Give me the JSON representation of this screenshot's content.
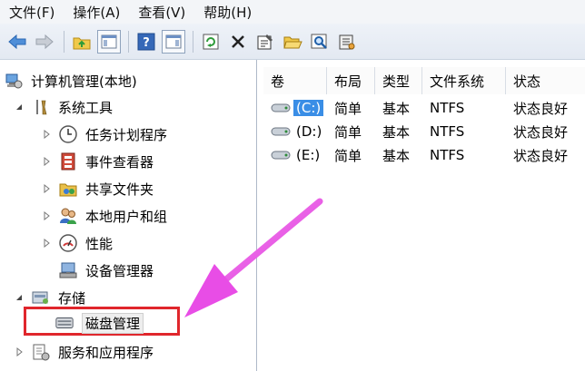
{
  "menu": [
    "文件(F)",
    "操作(A)",
    "查看(V)",
    "帮助(H)"
  ],
  "toolbar": {
    "buttons": [
      "back-arrow-icon",
      "forward-arrow-icon",
      "up-folder-icon",
      "show-hide-tree-icon",
      "help-icon",
      "show-action-pane-icon",
      "refresh-icon",
      "delete-icon",
      "properties-icon",
      "open-icon",
      "search-icon",
      "settings-icon"
    ]
  },
  "tree": {
    "root": "计算机管理(本地)",
    "system_tools": "系统工具",
    "task_scheduler": "任务计划程序",
    "event_viewer": "事件查看器",
    "shared_folders": "共享文件夹",
    "local_users": "本地用户和组",
    "performance": "性能",
    "device_manager": "设备管理器",
    "storage": "存储",
    "disk_management": "磁盘管理",
    "services": "服务和应用程序"
  },
  "table": {
    "headers": [
      "卷",
      "布局",
      "类型",
      "文件系统",
      "状态"
    ],
    "rows": [
      {
        "volume": "(C:)",
        "layout": "简单",
        "type": "基本",
        "fs": "NTFS",
        "status": "状态良好"
      },
      {
        "volume": "(D:)",
        "layout": "简单",
        "type": "基本",
        "fs": "NTFS",
        "status": "状态良好"
      },
      {
        "volume": "(E:)",
        "layout": "简单",
        "type": "基本",
        "fs": "NTFS",
        "status": "状态良好"
      }
    ]
  },
  "colors": {
    "highlight": "#e0262c",
    "arrow": "#e84de6",
    "selection": "#3a8ee6"
  }
}
